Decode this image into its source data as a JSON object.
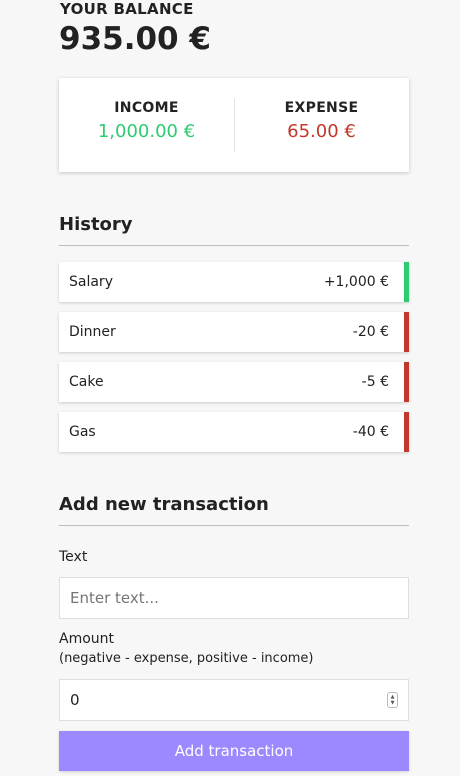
{
  "balance": {
    "label": "YOUR BALANCE",
    "value": "935.00 €"
  },
  "summary": {
    "income": {
      "label": "INCOME",
      "value": "1,000.00 €"
    },
    "expense": {
      "label": "EXPENSE",
      "value": "65.00 €"
    }
  },
  "history": {
    "title": "History",
    "items": [
      {
        "text": "Salary",
        "amount": "+1,000 €",
        "type": "income"
      },
      {
        "text": "Dinner",
        "amount": "-20 €",
        "type": "expense"
      },
      {
        "text": "Cake",
        "amount": "-5 €",
        "type": "expense"
      },
      {
        "text": "Gas",
        "amount": "-40 €",
        "type": "expense"
      }
    ]
  },
  "form": {
    "title": "Add new transaction",
    "text_label": "Text",
    "text_placeholder": "Enter text...",
    "amount_label": "Amount",
    "amount_hint": "(negative - expense, positive - income)",
    "amount_value": "0",
    "submit_label": "Add transaction"
  },
  "colors": {
    "income": "#2ecc71",
    "expense": "#c0392b",
    "accent": "#9c88ff"
  }
}
